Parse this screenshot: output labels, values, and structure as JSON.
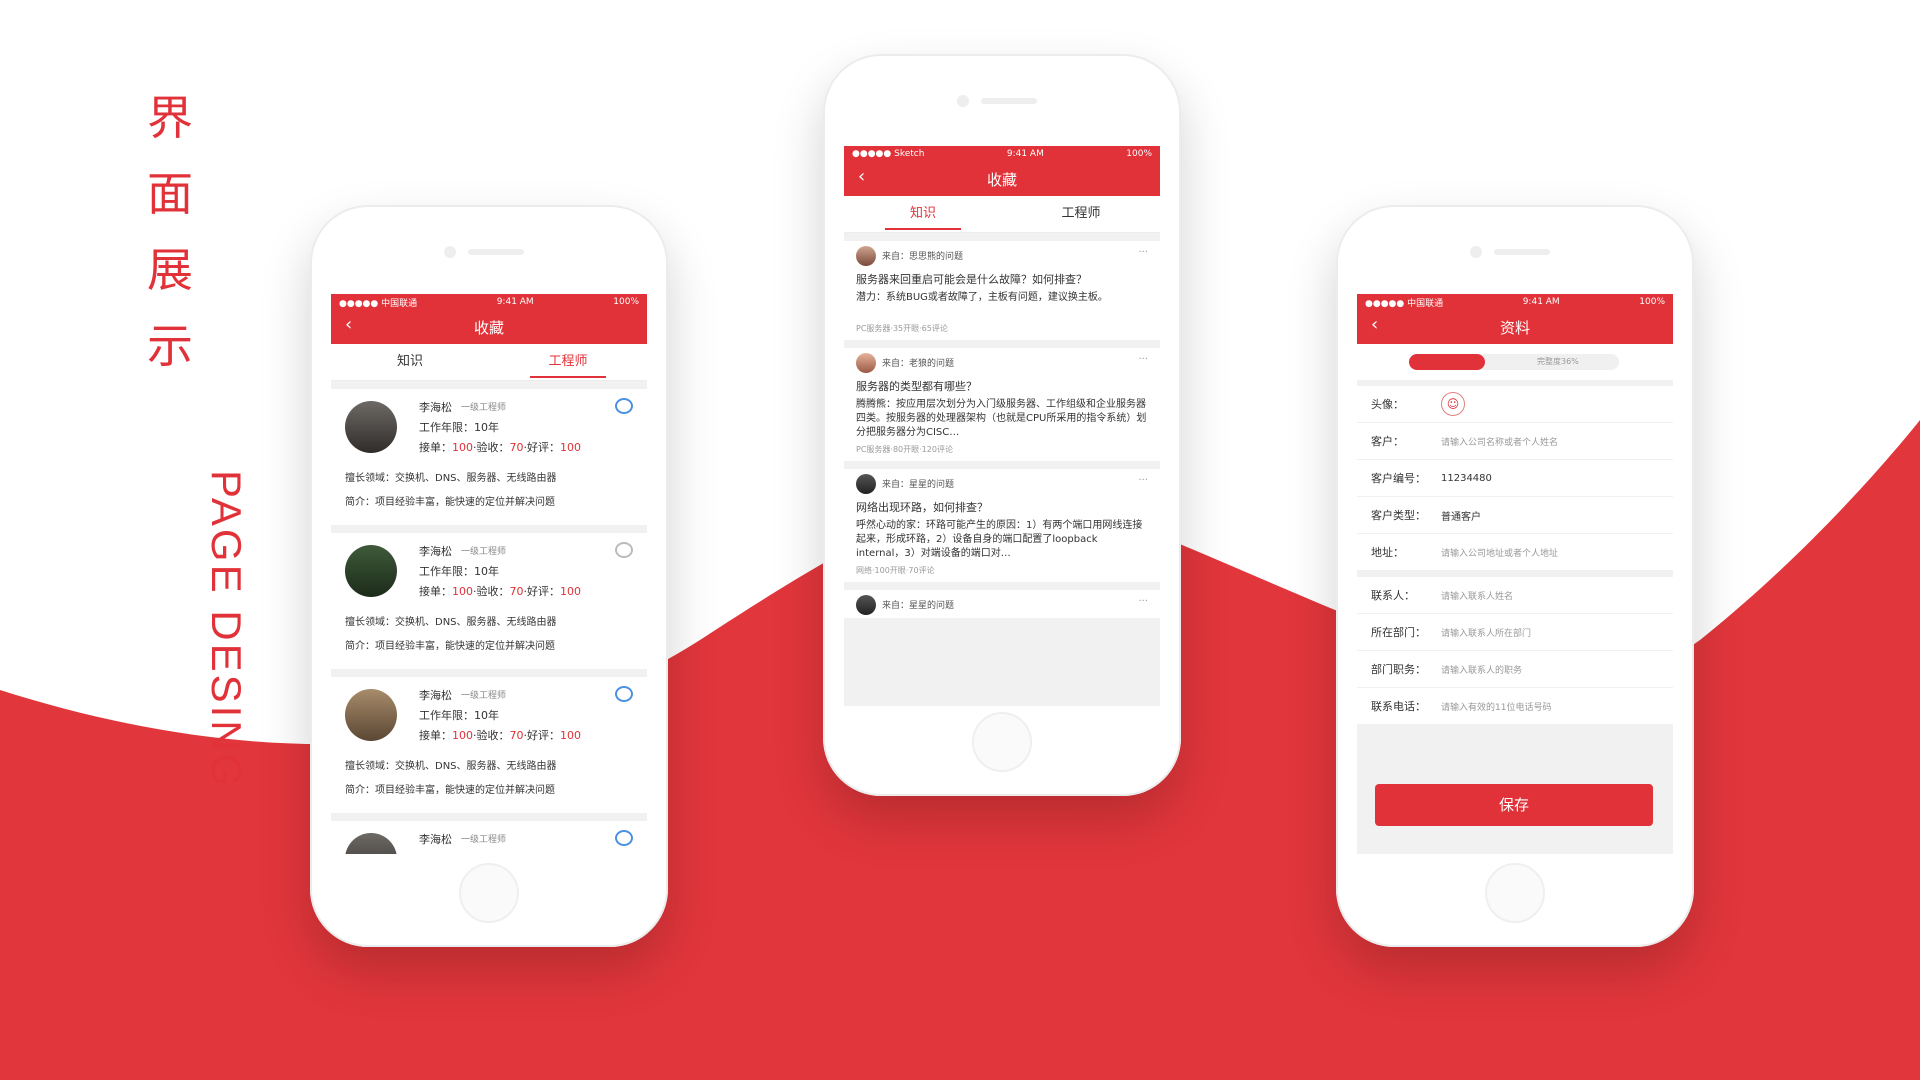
{
  "side_title": {
    "cn": [
      "界",
      "面",
      "展",
      "示"
    ],
    "en": "PAGE DESING"
  },
  "colors": {
    "accent": "#e03238"
  },
  "phone_left": {
    "status": {
      "carrier": "●●●●● 中国联通",
      "time": "9:41 AM",
      "battery": "100%"
    },
    "nav": {
      "back_icon": "chevron-left-icon",
      "title": "收藏"
    },
    "tabs": [
      "知识",
      "工程师"
    ],
    "active_tab": "工程师",
    "engineers": [
      {
        "name": "李海松",
        "level": "一级工程师",
        "years": "工作年限：10年",
        "orders_label": "接单：",
        "orders": "100",
        "accept_label": "·验收：",
        "accept": "70",
        "good_label": "·好评：",
        "good": "100",
        "field": "擅长领域：交换机、DNS、服务器、无线路由器",
        "intro": "简介：项目经验丰富，能快速的定位并解决问题"
      },
      {
        "name": "李海松",
        "level": "一级工程师",
        "years": "工作年限：10年",
        "orders_label": "接单：",
        "orders": "100",
        "accept_label": "·验收：",
        "accept": "70",
        "good_label": "·好评：",
        "good": "100",
        "field": "擅长领域：交换机、DNS、服务器、无线路由器",
        "intro": "简介：项目经验丰富，能快速的定位并解决问题"
      },
      {
        "name": "李海松",
        "level": "一级工程师",
        "years": "工作年限：10年",
        "orders_label": "接单：",
        "orders": "100",
        "accept_label": "·验收：",
        "accept": "70",
        "good_label": "·好评：",
        "good": "100",
        "field": "擅长领域：交换机、DNS、服务器、无线路由器",
        "intro": "简介：项目经验丰富，能快速的定位并解决问题"
      },
      {
        "name": "李海松",
        "level": "一级工程师"
      }
    ]
  },
  "phone_center": {
    "status": {
      "carrier": "●●●●● Sketch",
      "time": "9:41 AM",
      "battery": "100%"
    },
    "nav": {
      "back_icon": "chevron-left-icon",
      "title": "收藏"
    },
    "tabs": [
      "知识",
      "工程师"
    ],
    "active_tab": "知识",
    "posts": [
      {
        "from": "来自：思思熊的问题",
        "title": "服务器来回重启可能会是什么故障？如何排查？",
        "body": "潜力：系统BUG或者故障了，主板有问题，建议换主板。",
        "meta": "PC服务器·35开眼·65评论"
      },
      {
        "from": "来自：老狼的问题",
        "title": "服务器的类型都有哪些？",
        "body": "腾腾熊：按应用层次划分为入门级服务器、工作组级和企业服务器四类。按服务器的处理器架构（也就是CPU所采用的指令系统）划分把服务器分为CISC…",
        "meta": "PC服务器·80开眼·120评论"
      },
      {
        "from": "来自：星星的问题",
        "title": "网络出现环路，如何排查？",
        "body": "呼然心动的家：环路可能产生的原因：1）有两个端口用网线连接起来，形成环路，2）设备自身的端口配置了loopback internal，3）对端设备的端口对…",
        "meta": "网络·100开眼·70评论"
      },
      {
        "from": "来自：星星的问题"
      }
    ]
  },
  "phone_right": {
    "status": {
      "carrier": "●●●●● 中国联通",
      "time": "9:41 AM",
      "battery": "100%"
    },
    "nav": {
      "back_icon": "chevron-left-icon",
      "title": "资料"
    },
    "progress": {
      "value": 0.36,
      "label": "完整度36%"
    },
    "group1": [
      {
        "label": "头像：",
        "type": "avatar"
      },
      {
        "label": "客户：",
        "placeholder": "请输入公司名称或者个人姓名"
      },
      {
        "label": "客户编号：",
        "value": "11234480"
      },
      {
        "label": "客户类型：",
        "value": "普通客户"
      },
      {
        "label": "地址：",
        "placeholder": "请输入公司地址或者个人地址"
      }
    ],
    "group2": [
      {
        "label": "联系人：",
        "placeholder": "请输入联系人姓名"
      },
      {
        "label": "所在部门：",
        "placeholder": "请输入联系人所在部门"
      },
      {
        "label": "部门职务：",
        "placeholder": "请输入联系人的职务"
      },
      {
        "label": "联系电话：",
        "placeholder": "请输入有效的11位电话号码"
      }
    ],
    "save_label": "保存"
  }
}
